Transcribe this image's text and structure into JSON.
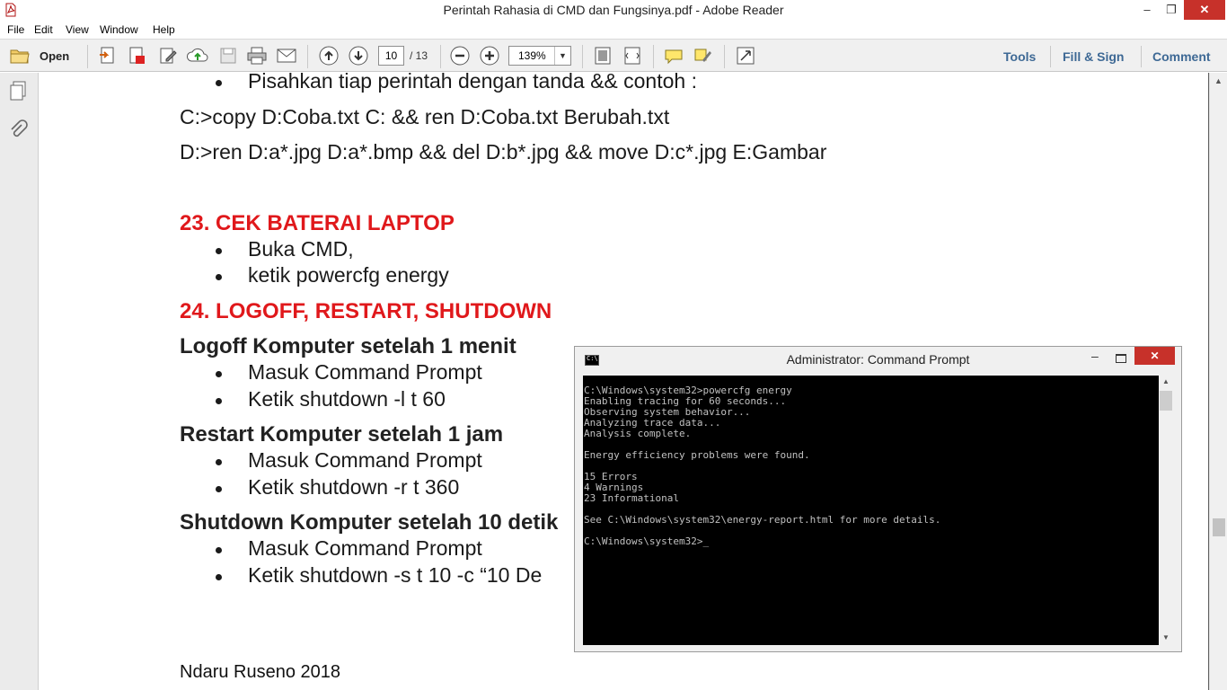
{
  "window": {
    "title": "Perintah Rahasia di CMD dan Fungsinya.pdf - Adobe Reader",
    "minimize": "–",
    "maximize": "❐",
    "close": "✕"
  },
  "menu": [
    "File",
    "Edit",
    "View",
    "Window",
    "Help"
  ],
  "toolbar": {
    "open_label": "Open",
    "current_page": "10",
    "total_pages": "/ 13",
    "zoom": "139%",
    "tools": "Tools",
    "fill_sign": "Fill & Sign",
    "comment": "Comment"
  },
  "document": {
    "lines": {
      "bullet_top": "Pisahkan tiap perintah dengan tanda && contoh :",
      "code1": "C:>copy D:Coba.txt C: && ren D:Coba.txt Berubah.txt",
      "code2": "D:>ren D:a*.jpg D:a*.bmp && del D:b*.jpg && move D:c*.jpg E:Gambar"
    },
    "section23": {
      "heading": "23. CEK BATERAI LAPTOP",
      "items": [
        "Buka CMD,",
        "ketik powercfg energy"
      ]
    },
    "section24": {
      "heading": "24. LOGOFF, RESTART, SHUTDOWN",
      "logoff_title": "Logoff Komputer setelah 1 menit",
      "logoff_items": [
        "Masuk Command Prompt",
        "Ketik shutdown -l t 60"
      ],
      "restart_title": "Restart Komputer setelah 1 jam",
      "restart_items": [
        "Masuk Command Prompt",
        "Ketik shutdown -r t 360"
      ],
      "shutdown_title": "Shutdown Komputer setelah 10 detik",
      "shutdown_items": [
        "Masuk Command Prompt",
        "Ketik shutdown -s t 10 -c “10 De"
      ]
    },
    "footer": "Ndaru Ruseno 2018"
  },
  "cmd_window": {
    "title": "Administrator: Command Prompt",
    "icon_text": "C:\\",
    "minimize": "–",
    "close": "✕",
    "output": "C:\\Windows\\system32>powercfg energy\nEnabling tracing for 60 seconds...\nObserving system behavior...\nAnalyzing trace data...\nAnalysis complete.\n\nEnergy efficiency problems were found.\n\n15 Errors\n4 Warnings\n23 Informational\n\nSee C:\\Windows\\system32\\energy-report.html for more details.\n\nC:\\Windows\\system32>_"
  },
  "colors": {
    "heading_red": "#e0181b",
    "link_blue": "#3e6995",
    "close_red": "#c7312a",
    "console_bg": "#000000",
    "console_fg": "#c0c0c0"
  },
  "icons": [
    "pdf-app-icon",
    "open-folder-icon",
    "create-pdf-icon",
    "convert-pdf-icon",
    "edit-icon",
    "upload-icon",
    "save-icon",
    "print-icon",
    "email-icon",
    "page-up-icon",
    "page-down-icon",
    "zoom-out-icon",
    "zoom-in-icon",
    "fit-page-icon",
    "fit-width-icon",
    "comment-icon",
    "highlight-icon",
    "fullscreen-icon",
    "pages-icon",
    "attachment-icon"
  ]
}
